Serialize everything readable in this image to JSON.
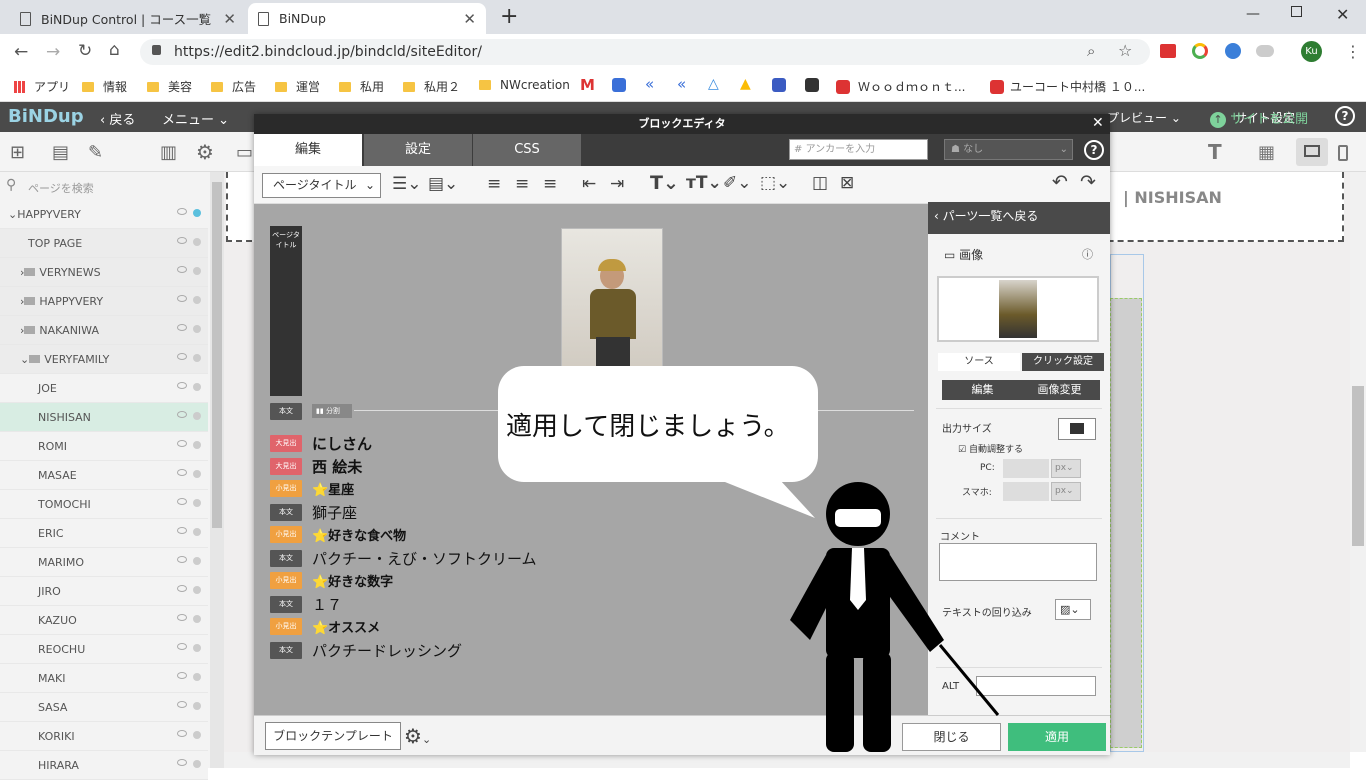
{
  "browser": {
    "tabs": [
      {
        "title": "BiNDup Control | コース一覧"
      },
      {
        "title": "BiNDup"
      }
    ],
    "url": "https://edit2.bindcloud.jp/bindcld/siteEditor/",
    "avatar": "Ku"
  },
  "bookmarks": [
    "アプリ",
    "情報",
    "美容",
    "広告",
    "運営",
    "私用",
    "私用２",
    "NWcreation",
    "Ｗｏｏｄｍｏｎｔ...",
    "ユーコート中村橋 １０..."
  ],
  "app": {
    "logo": "BiNDup",
    "back": "戻る",
    "menu": "メニュー",
    "site_settings": "サイト設定",
    "preview": "プレビュー",
    "publish": "サイトを公開",
    "help": "?"
  },
  "sidebar": {
    "search_placeholder": "ページを検索",
    "items": [
      {
        "label": "HAPPYVERY"
      },
      {
        "label": "TOP PAGE"
      },
      {
        "label": "VERYNEWS"
      },
      {
        "label": "HAPPYVERY"
      },
      {
        "label": "NAKANIWA"
      },
      {
        "label": "VERYFAMILY"
      },
      {
        "label": "JOE"
      },
      {
        "label": "NISHISAN"
      },
      {
        "label": "ROMI"
      },
      {
        "label": "MASAE"
      },
      {
        "label": "TOMOCHI"
      },
      {
        "label": "ERIC"
      },
      {
        "label": "MARIMO"
      },
      {
        "label": "JIRO"
      },
      {
        "label": "KAZUO"
      },
      {
        "label": "REOCHU"
      },
      {
        "label": "MAKI"
      },
      {
        "label": "SASA"
      },
      {
        "label": "KORIKI"
      },
      {
        "label": "HIRARA"
      }
    ]
  },
  "preview": {
    "header_text": "| NISHISAN"
  },
  "modal": {
    "title": "ブロックエディタ",
    "tabs": [
      "編集",
      "設定",
      "CSS"
    ],
    "anchor_placeholder": "アンカーを入力",
    "none_label": "なし",
    "style_select": "ページタイトル"
  },
  "canvas": {
    "page_title_tag": "ページタイトル",
    "split_label": "分割",
    "rows": [
      {
        "tag": "本文",
        "tagclass": "gry",
        "text": ""
      },
      {
        "tag": "大見出",
        "tagclass": "red",
        "text": "にしさん"
      },
      {
        "tag": "大見出",
        "tagclass": "red",
        "text": "西 絵未"
      },
      {
        "tag": "小見出",
        "tagclass": "org",
        "text": "⭐星座"
      },
      {
        "tag": "本文",
        "tagclass": "gry",
        "text": "獅子座"
      },
      {
        "tag": "小見出",
        "tagclass": "org",
        "text": "⭐好きな食べ物"
      },
      {
        "tag": "本文",
        "tagclass": "gry",
        "text": "パクチー・えび・ソフトクリーム"
      },
      {
        "tag": "小見出",
        "tagclass": "org",
        "text": "⭐好きな数字"
      },
      {
        "tag": "本文",
        "tagclass": "gry",
        "text": "１７"
      },
      {
        "tag": "小見出",
        "tagclass": "org",
        "text": "⭐オススメ"
      },
      {
        "tag": "本文",
        "tagclass": "gry",
        "text": "パクチードレッシング"
      }
    ]
  },
  "panel": {
    "back": "パーツ一覧へ戻る",
    "image_label": "画像",
    "tab_source": "ソース",
    "tab_click": "クリック設定",
    "edit": "編集",
    "change": "画像変更",
    "output_size": "出力サイズ",
    "auto_adjust": "自動調整する",
    "pc": "PC:",
    "phone": "スマホ:",
    "unit": "px",
    "comment": "コメント",
    "text_wrap": "テキストの回り込み",
    "alt": "ALT"
  },
  "footer": {
    "template": "ブロックテンプレート",
    "close": "閉じる",
    "apply": "適用"
  },
  "speech": {
    "text": "適用して閉じましょう。"
  }
}
